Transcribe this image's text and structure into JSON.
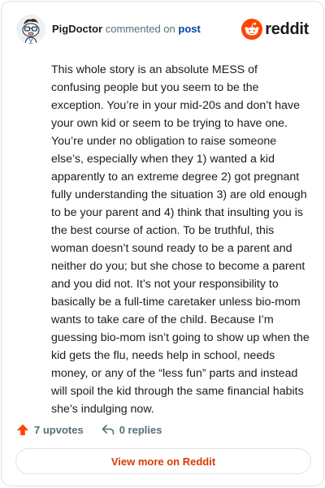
{
  "comment": {
    "author": "PigDoctor",
    "action": "commented on",
    "target": "post",
    "body": "This whole story is an absolute MESS of confusing people but you seem to be the exception. You’re in your mid-20s and don’t have your own kid or seem to be trying to have one. You’re under no obligation to raise someone else’s, especially when they 1) wanted a kid apparently to an extreme degree 2) got pregnant fully understanding the situation 3) are old enough to be your parent and 4) think that insulting you is the best course of action. To be truthful, this woman doesn’t sound ready to be a parent and neither do you; but she chose to become a parent and you did not. It’s not your responsibility to basically be a full-time caretaker unless bio-mom wants to take care of the child. Because I’m guessing bio-mom isn’t going to show up when the kid gets the flu, needs help in school, needs money, or any of the “less fun” parts and instead will spoil the kid through the same financial habits she’s indulging now."
  },
  "brand": {
    "name": "reddit",
    "color": "#ff4500",
    "icon": "reddit-snoo-icon"
  },
  "footer": {
    "upvotes_label": "7 upvotes",
    "replies_label": "0 replies",
    "upvote_icon": "upvote-arrow-icon",
    "reply_icon": "reply-icon"
  },
  "cta": {
    "label": "View more on Reddit",
    "color": "#d93a00"
  },
  "colors": {
    "link": "#0045ac",
    "upvote": "#ff4500",
    "muted": "#576f76",
    "border": "#dfe3e6"
  }
}
